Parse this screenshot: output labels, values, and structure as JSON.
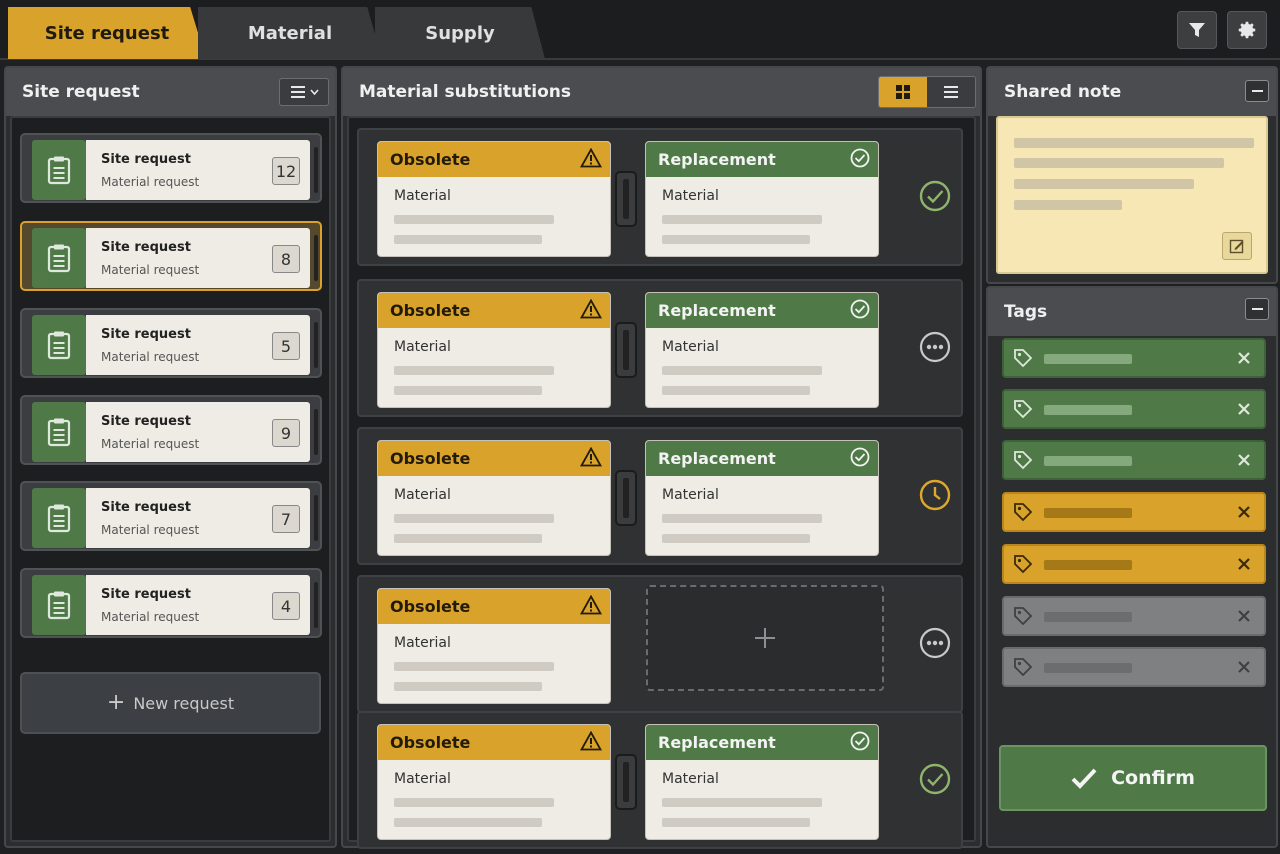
{
  "tabs": [
    {
      "label": "Site request",
      "active": true
    },
    {
      "label": "Material",
      "active": false
    },
    {
      "label": "Supply",
      "active": false
    }
  ],
  "toolbar": {
    "filter_icon": "filter-icon",
    "settings_icon": "gear-icon"
  },
  "left_panel": {
    "title": "Site request",
    "menu_icon": "list-menu-icon",
    "requests": [
      {
        "title": "Site request",
        "subtitle": "Material request",
        "count": "12",
        "selected": false
      },
      {
        "title": "Site request",
        "subtitle": "Material request",
        "count": "8",
        "selected": true
      },
      {
        "title": "Site request",
        "subtitle": "Material request",
        "count": "5",
        "selected": false
      },
      {
        "title": "Site request",
        "subtitle": "Material request",
        "count": "9",
        "selected": false
      },
      {
        "title": "Site request",
        "subtitle": "Material request",
        "count": "7",
        "selected": false
      },
      {
        "title": "Site request",
        "subtitle": "Material request",
        "count": "4",
        "selected": false
      }
    ],
    "new_request_label": "New request"
  },
  "middle_panel": {
    "title": "Material substitutions",
    "view_modes": [
      "grid",
      "list"
    ],
    "active_view": "grid",
    "rows": [
      {
        "obsolete": {
          "title": "Obsolete",
          "label": "Material"
        },
        "replacement": {
          "title": "Replacement",
          "label": "Material"
        },
        "status": "approved"
      },
      {
        "obsolete": {
          "title": "Obsolete",
          "label": "Material"
        },
        "replacement": {
          "title": "Replacement",
          "label": "Material"
        },
        "status": "more"
      },
      {
        "obsolete": {
          "title": "Obsolete",
          "label": "Material"
        },
        "replacement": {
          "title": "Replacement",
          "label": "Material"
        },
        "status": "pending"
      },
      {
        "obsolete": {
          "title": "Obsolete",
          "label": "Material"
        },
        "replacement": null,
        "status": "more"
      },
      {
        "obsolete": {
          "title": "Obsolete",
          "label": "Material"
        },
        "replacement": {
          "title": "Replacement",
          "label": "Material"
        },
        "status": "approved"
      }
    ]
  },
  "right_panel": {
    "note_title": "Shared note",
    "tags_title": "Tags",
    "tags": [
      {
        "color": "green"
      },
      {
        "color": "green"
      },
      {
        "color": "green"
      },
      {
        "color": "yellow"
      },
      {
        "color": "yellow"
      },
      {
        "color": "grey"
      },
      {
        "color": "grey"
      }
    ],
    "confirm_label": "Confirm"
  },
  "colors": {
    "accent": "#d9a22a",
    "success": "#4f7a48",
    "background": "#1f2021"
  }
}
